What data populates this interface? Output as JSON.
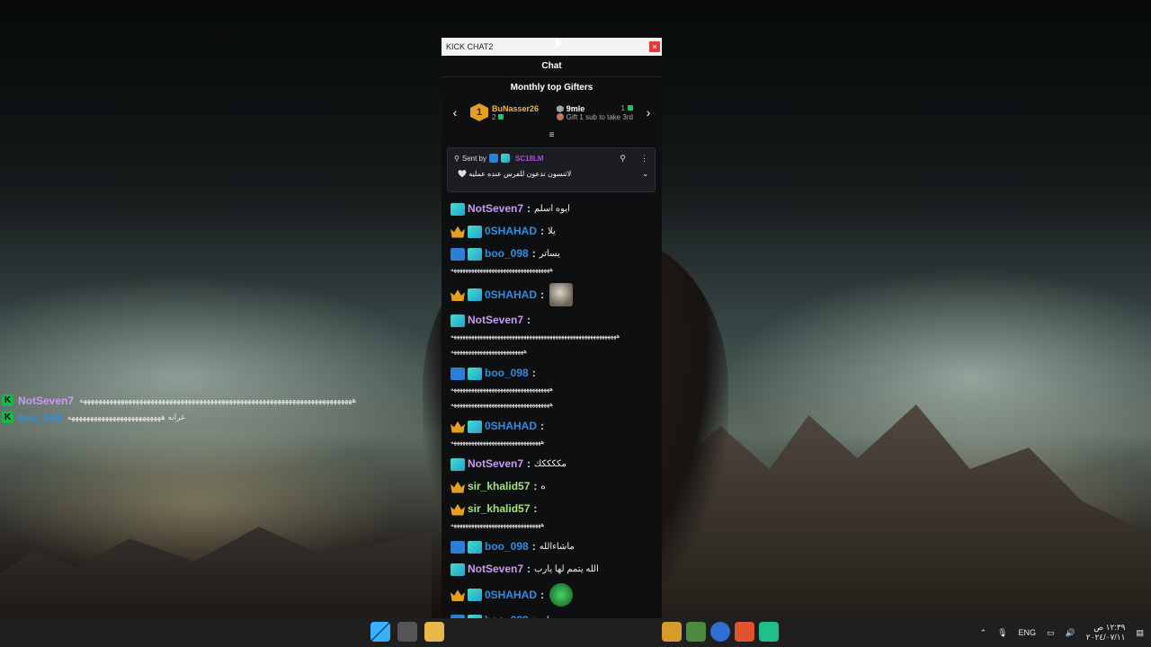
{
  "window": {
    "title": "KICK CHAT2",
    "close_label": "×",
    "header": "Chat"
  },
  "gifters": {
    "title": "Monthly top Gifters",
    "prev": "‹",
    "next": "›",
    "first": {
      "rank": "1",
      "name": "BuNasser26",
      "count": "2"
    },
    "second": {
      "name": "9mle",
      "count": "1",
      "hint": "Gift 1 sub to take 3rd"
    }
  },
  "pinned": {
    "label": "Sent by",
    "sender": "SC18LM",
    "message": "لاتنسون تدعون للفرس عنده عمليه",
    "heart": "🤍",
    "chevron": "⌄",
    "menu": "⋮",
    "pin": "📌"
  },
  "messages": [
    {
      "badges": [
        "og"
      ],
      "user": "NotSeven7",
      "color": "purple",
      "text": "ايوه اسلم"
    },
    {
      "badges": [
        "crown",
        "og"
      ],
      "user": "0SHAHAD",
      "color": "blue",
      "text": "يلا"
    },
    {
      "badges": [
        "mod",
        "og"
      ],
      "user": "boo_098",
      "color": "blue",
      "text": "يساتر",
      "long": "ههههههههههههههههههههههههههههههههههه"
    },
    {
      "badges": [
        "crown",
        "og"
      ],
      "user": "0SHAHAD",
      "color": "blue",
      "emote": "cat"
    },
    {
      "badges": [
        "og"
      ],
      "user": "NotSeven7",
      "color": "purple",
      "text": "",
      "long": "هههههههههههههههههههههههههههههههههههههههههههههههههههههههههه",
      "long2": "هههههههههههههههههههههههههه"
    },
    {
      "badges": [
        "mod",
        "og"
      ],
      "user": "boo_098",
      "color": "blue",
      "text": "",
      "long": "ههههههههههههههههههههههههههههههههههه",
      "long2": "ههههههههههههههههههههههههههههههههههه"
    },
    {
      "badges": [
        "crown",
        "og"
      ],
      "user": "0SHAHAD",
      "color": "blue",
      "text": "",
      "long": "هههههههههههههههههههههههههههههههه"
    },
    {
      "badges": [
        "og"
      ],
      "user": "NotSeven7",
      "color": "purple",
      "text": "مككككك"
    },
    {
      "badges": [
        "crown"
      ],
      "user": "sir_khalid57",
      "color": "green",
      "text": "ه"
    },
    {
      "badges": [
        "crown"
      ],
      "user": "sir_khalid57",
      "color": "green",
      "text": "",
      "long": "هههههههههههههههههههههههههههههههه"
    },
    {
      "badges": [
        "mod",
        "og"
      ],
      "user": "boo_098",
      "color": "blue",
      "text": "ماشاءالله"
    },
    {
      "badges": [
        "og"
      ],
      "user": "NotSeven7",
      "color": "purple",
      "text": "الله يتمم لها يارب"
    },
    {
      "badges": [
        "crown",
        "og"
      ],
      "user": "0SHAHAD",
      "color": "blue",
      "emote": "green"
    },
    {
      "badges": [
        "mod",
        "og"
      ],
      "user": "boo_098",
      "color": "blue",
      "text": "ايه",
      "long": "ههههههههههههههههههههههههههههههههههه"
    }
  ],
  "overlay": [
    {
      "badge": "K",
      "user": "NotSeven7",
      "color": "#c99bf5",
      "text": "هههههههههههههههههههههههههههههههههههههههههههههههههههههههههههههههههههههههههه"
    },
    {
      "badge": "K",
      "user": "boo_098",
      "color": "#2f8ee0",
      "text": "غرابه هههههههههههههههههههههههههه"
    }
  ],
  "tray": {
    "language": "ENG",
    "time": "١٢:٣٩ ص",
    "date": "٢٠٢٤/٠٧/١١"
  }
}
